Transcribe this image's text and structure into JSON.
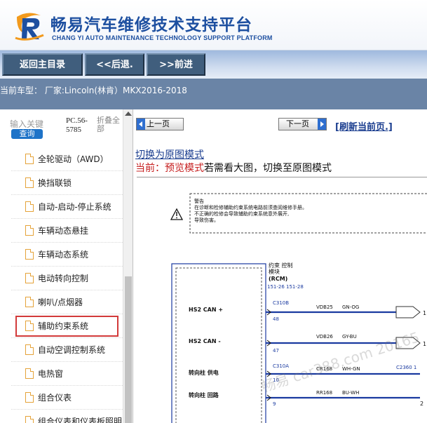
{
  "header": {
    "title": "畅易汽车维修技术支持平台",
    "subtitle": "CHANG YI AUTO MAINTENANCE TECHNOLOGY SUPPORT PLATFORM"
  },
  "nav": {
    "home": "返回主目录",
    "back": "<<后退.",
    "forward": ">>前进"
  },
  "model_bar": {
    "text": "当前车型：  厂家:Lincoln(林肯）MKX2016-2018"
  },
  "sidebar": {
    "keyword_label": "输入关键",
    "search_button": "查询",
    "code": "PC.56-5785",
    "fold": "折叠全部",
    "items": [
      {
        "label": "全轮驱动（AWD）"
      },
      {
        "label": "换挡联锁"
      },
      {
        "label": "自动-启动-停止系统"
      },
      {
        "label": "车辆动态悬挂"
      },
      {
        "label": "车辆动态系统"
      },
      {
        "label": "电动转向控制"
      },
      {
        "label": "喇叭/点烟器"
      },
      {
        "label": "辅助约束系统"
      },
      {
        "label": "自动空调控制系统"
      },
      {
        "label": "电热窗"
      },
      {
        "label": "组合仪表"
      },
      {
        "label": "组合仪表和仪表板照明"
      }
    ],
    "selected_index": 7
  },
  "main": {
    "prev_label": "上一页",
    "next_label": "下一页",
    "refresh_label": "[刷新当前页.]",
    "mode_link": "切换为原图模式",
    "mode_prefix": "当前：预览模式",
    "mode_suffix": "若需看大图，切换至原图模式"
  },
  "diagram": {
    "warning_title": "警告",
    "warning_line1": "在诊断和检修辅助约束系统电路前须查阅维修手册。",
    "warning_line2": "不正确的检修会导致辅助约束系统意外展开,",
    "warning_line3": "导致伤害。",
    "module_line1": "约束 控制",
    "module_line2": "模块",
    "module_line3": "(RCM)",
    "module_refs": "151-26   151-28",
    "pins": [
      {
        "label": "HS2 CAN +",
        "connector": "C310B",
        "pin": "48",
        "circuit": "VDB25",
        "color": "GN-OG",
        "right": "1"
      },
      {
        "label": "HS2 CAN -",
        "connector": "",
        "pin": "47",
        "circuit": "VDB26",
        "color": "GY-BU",
        "right": "1"
      },
      {
        "label": "转向柱 供电",
        "connector": "C310A",
        "pin": "10",
        "circuit": "CR168",
        "color": "WH-GN",
        "right": "C2360 1"
      },
      {
        "label": "转向柱 回路",
        "connector": "",
        "pin": "9",
        "circuit": "RR168",
        "color": "BU-WH",
        "right": "2"
      }
    ],
    "watermark": "畅易 car388.com 20165"
  },
  "colors": {
    "brand_blue": "#1d4fa0",
    "nav_button": "#405e7d",
    "model_bar": "#6a84a6",
    "selection_border": "#d23a3a",
    "wire_blue": "#1a3aa0",
    "link_blue": "#1a3d8f"
  }
}
